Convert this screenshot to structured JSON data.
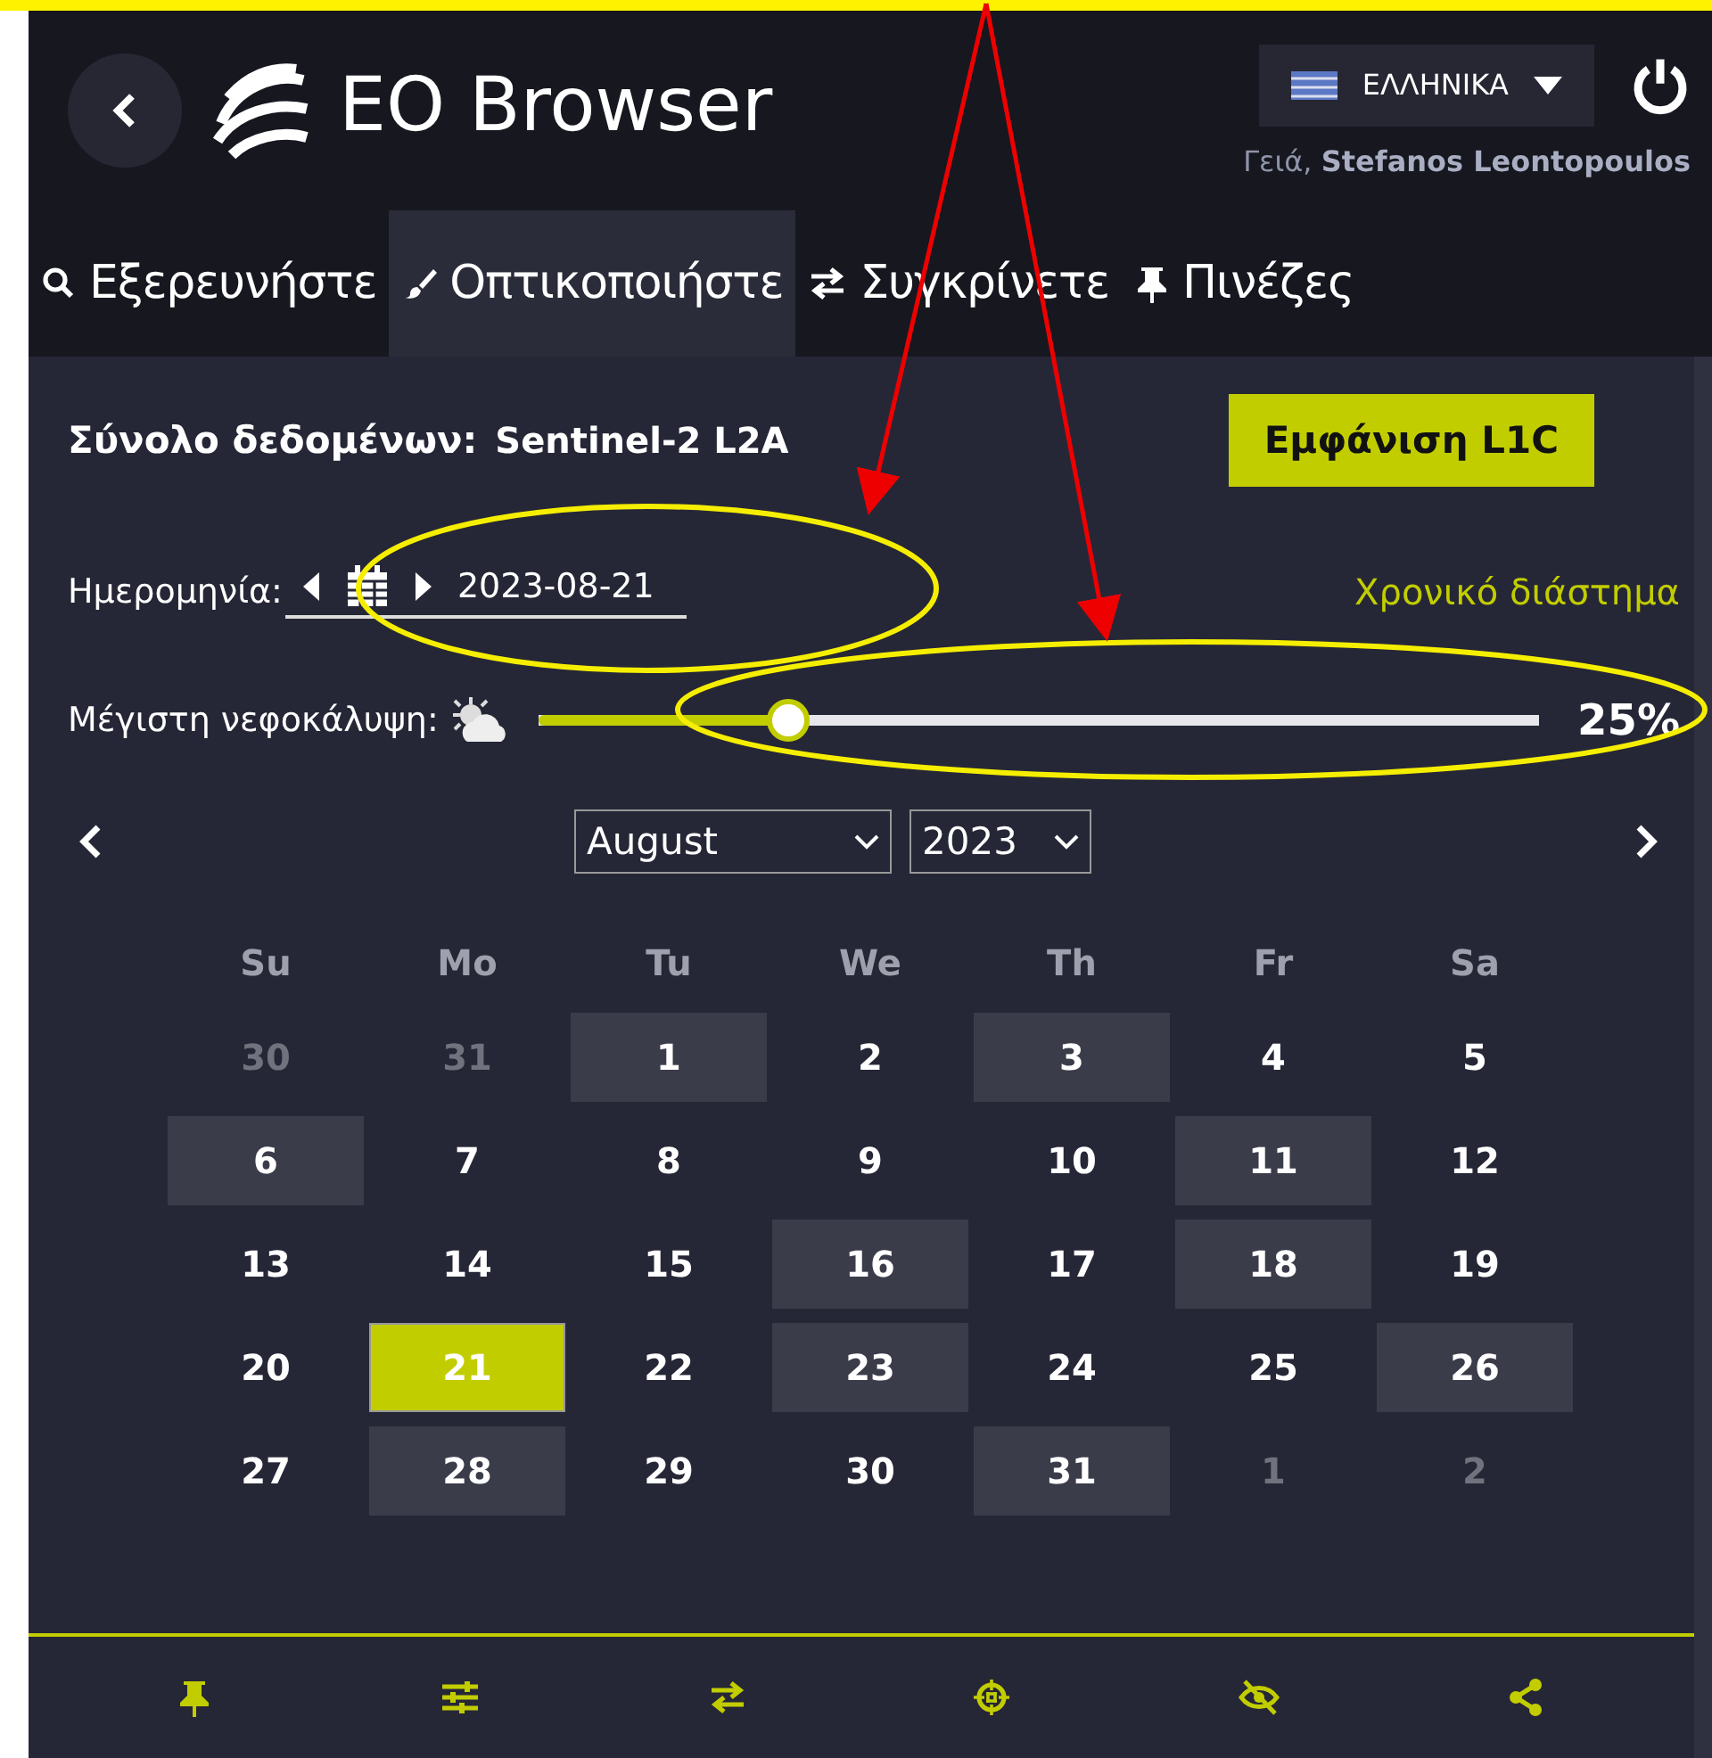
{
  "header": {
    "title": "EO Browser",
    "language": "ΕΛΛΗΝΙΚΑ",
    "greeting": "Γειά,",
    "user": "Stefanos Leontopoulos"
  },
  "tabs": [
    {
      "label": "Εξερευνήστε",
      "selected": false
    },
    {
      "label": "Οπτικοποιήστε",
      "selected": true
    },
    {
      "label": "Συγκρίνετε",
      "selected": false
    },
    {
      "label": "Πινέζες",
      "selected": false
    }
  ],
  "dataset": {
    "label": "Σύνολο δεδομένων:",
    "value": "Sentinel-2 L2A",
    "button": "Εμφάνιση L1C"
  },
  "date": {
    "label": "Ημερομηνία:",
    "value": "2023-08-21",
    "range_link": "Χρονικό διάστημα"
  },
  "cloud": {
    "label": "Μέγιστη νεφοκάλυψη:",
    "level": 0.25,
    "reading": "25%"
  },
  "calendar": {
    "month": "August",
    "year": "2023",
    "weekdays": [
      "Su",
      "Mo",
      "Tu",
      "We",
      "Th",
      "Fr",
      "Sa"
    ],
    "days": [
      {
        "text": "30",
        "outside": true,
        "available": false,
        "selected": false
      },
      {
        "text": "31",
        "outside": true,
        "available": false,
        "selected": false
      },
      {
        "text": "1",
        "outside": false,
        "available": true,
        "selected": false
      },
      {
        "text": "2",
        "outside": false,
        "available": false,
        "selected": false
      },
      {
        "text": "3",
        "outside": false,
        "available": true,
        "selected": false
      },
      {
        "text": "4",
        "outside": false,
        "available": false,
        "selected": false
      },
      {
        "text": "5",
        "outside": false,
        "available": false,
        "selected": false
      },
      {
        "text": "6",
        "outside": false,
        "available": true,
        "selected": false
      },
      {
        "text": "7",
        "outside": false,
        "available": false,
        "selected": false
      },
      {
        "text": "8",
        "outside": false,
        "available": false,
        "selected": false
      },
      {
        "text": "9",
        "outside": false,
        "available": false,
        "selected": false
      },
      {
        "text": "10",
        "outside": false,
        "available": false,
        "selected": false
      },
      {
        "text": "11",
        "outside": false,
        "available": true,
        "selected": false
      },
      {
        "text": "12",
        "outside": false,
        "available": false,
        "selected": false
      },
      {
        "text": "13",
        "outside": false,
        "available": false,
        "selected": false
      },
      {
        "text": "14",
        "outside": false,
        "available": false,
        "selected": false
      },
      {
        "text": "15",
        "outside": false,
        "available": false,
        "selected": false
      },
      {
        "text": "16",
        "outside": false,
        "available": true,
        "selected": false
      },
      {
        "text": "17",
        "outside": false,
        "available": false,
        "selected": false
      },
      {
        "text": "18",
        "outside": false,
        "available": true,
        "selected": false
      },
      {
        "text": "19",
        "outside": false,
        "available": false,
        "selected": false
      },
      {
        "text": "20",
        "outside": false,
        "available": false,
        "selected": false
      },
      {
        "text": "21",
        "outside": false,
        "available": true,
        "selected": true
      },
      {
        "text": "22",
        "outside": false,
        "available": false,
        "selected": false
      },
      {
        "text": "23",
        "outside": false,
        "available": true,
        "selected": false
      },
      {
        "text": "24",
        "outside": false,
        "available": false,
        "selected": false
      },
      {
        "text": "25",
        "outside": false,
        "available": false,
        "selected": false
      },
      {
        "text": "26",
        "outside": false,
        "available": true,
        "selected": false
      },
      {
        "text": "27",
        "outside": false,
        "available": false,
        "selected": false
      },
      {
        "text": "28",
        "outside": false,
        "available": true,
        "selected": false
      },
      {
        "text": "29",
        "outside": false,
        "available": false,
        "selected": false
      },
      {
        "text": "30",
        "outside": false,
        "available": false,
        "selected": false
      },
      {
        "text": "31",
        "outside": false,
        "available": true,
        "selected": false
      },
      {
        "text": "1",
        "outside": true,
        "available": false,
        "selected": false
      },
      {
        "text": "2",
        "outside": true,
        "available": false,
        "selected": false
      }
    ]
  }
}
